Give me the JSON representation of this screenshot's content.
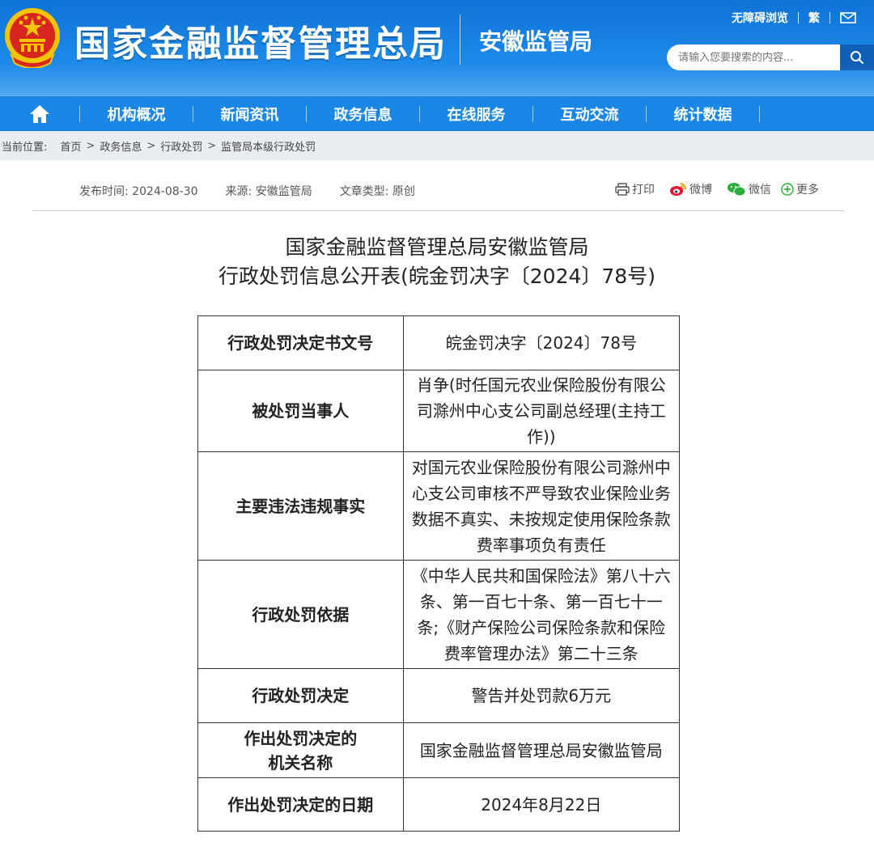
{
  "header": {
    "site_title": "国家金融监督管理总局",
    "sub_title": "安徽监管局",
    "links": [
      "无障碍浏览",
      "繁"
    ],
    "search_placeholder": "请输入您要搜索的内容..."
  },
  "nav": {
    "items": [
      "机构概况",
      "新闻资讯",
      "政务信息",
      "在线服务",
      "互动交流",
      "统计数据"
    ]
  },
  "breadcrumb": {
    "label": "当前位置:",
    "items": [
      "首页",
      "政务信息",
      "行政处罚",
      "监管局本级行政处罚"
    ]
  },
  "meta": {
    "publish": "发布时间:  2024-08-30",
    "source": "来源:  安徽监管局",
    "type": "文章类型:  原创"
  },
  "share": {
    "print": "打印",
    "weibo": "微博",
    "wechat": "微信",
    "more": "更多"
  },
  "doc": {
    "title_line1": "国家金融监督管理总局安徽监管局",
    "title_line2": "行政处罚信息公开表(皖金罚决字〔2024〕78号)"
  },
  "table": {
    "rows": [
      {
        "key": "行政处罚决定书文号",
        "value": "皖金罚决字〔2024〕78号"
      },
      {
        "key": "被处罚当事人",
        "value": "肖争(时任国元农业保险股份有限公司滁州中心支公司副总经理(主持工作))"
      },
      {
        "key": "主要违法违规事实",
        "value": "对国元农业保险股份有限公司滁州中心支公司审核不严导致农业保险业务数据不真实、未按规定使用保险条款费率事项负有责任"
      },
      {
        "key": "行政处罚依据",
        "value": "《中华人民共和国保险法》第八十六条、第一百七十条、第一百七十一条;《财产保险公司保险条款和保险费率管理办法》第二十三条"
      },
      {
        "key": "行政处罚决定",
        "value": "警告并处罚款6万元"
      },
      {
        "key": "作出处罚决定的机关名称",
        "value": "国家金融监督管理总局安徽监管局"
      },
      {
        "key": "作出处罚决定的日期",
        "value": "2024年8月22日"
      }
    ]
  },
  "colors": {
    "brand_blue": "#1a86e6",
    "emblem_red": "#d7261e",
    "emblem_gold": "#f5c400"
  }
}
